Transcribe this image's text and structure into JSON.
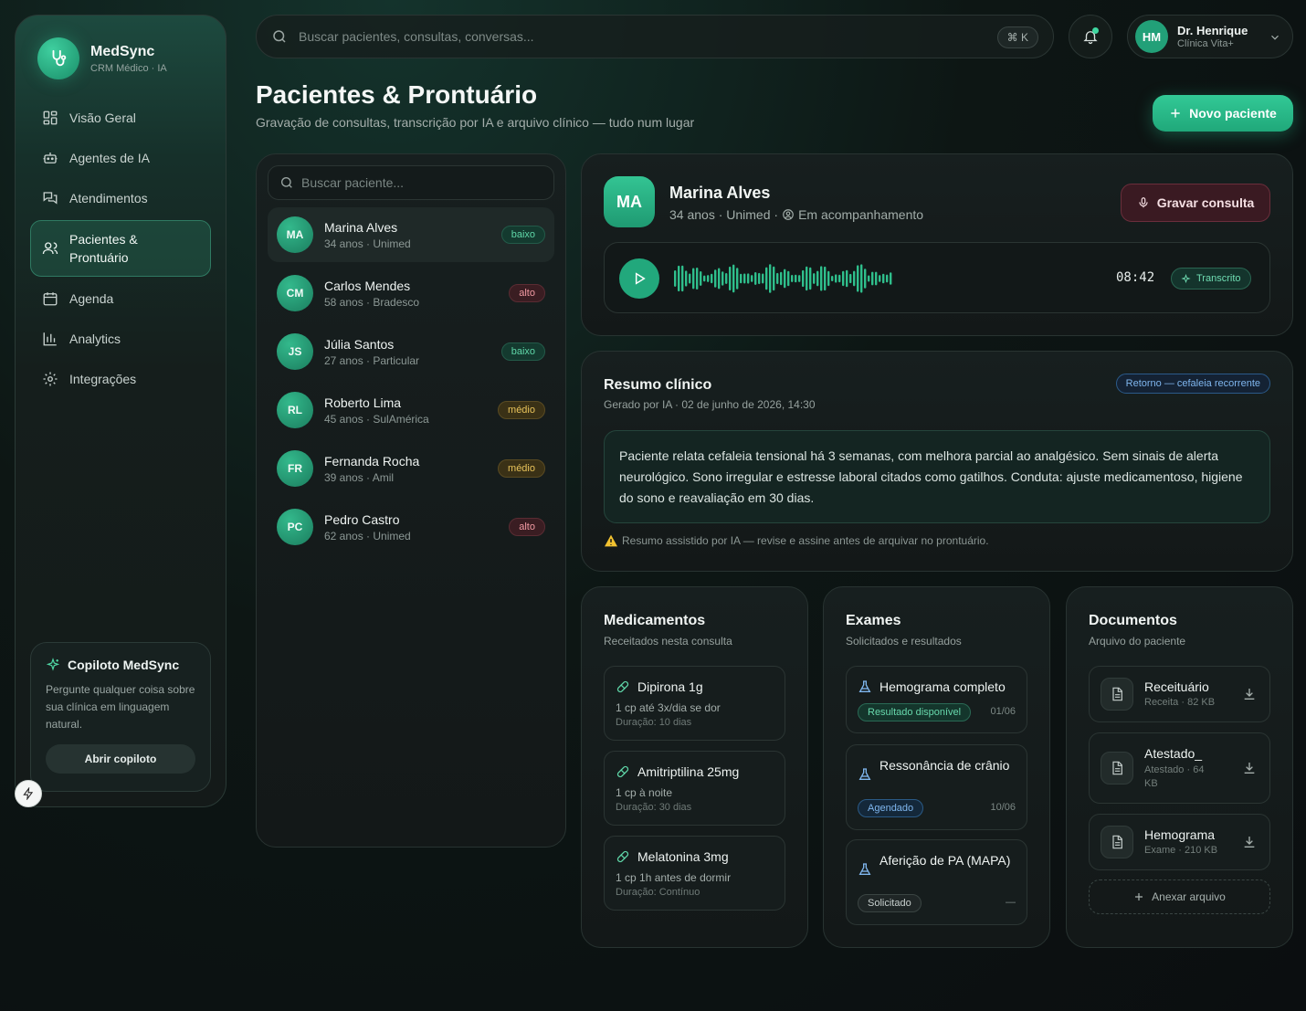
{
  "brand": {
    "name": "MedSync",
    "subtitle": "CRM Médico · IA"
  },
  "nav": [
    {
      "label": "Visão Geral",
      "icon": "grid-icon"
    },
    {
      "label": "Agentes de IA",
      "icon": "bot-icon"
    },
    {
      "label": "Atendimentos",
      "icon": "chat-icon"
    },
    {
      "label": "Pacientes & Prontuário",
      "icon": "users-icon",
      "active": true
    },
    {
      "label": "Agenda",
      "icon": "calendar-icon"
    },
    {
      "label": "Analytics",
      "icon": "bar-chart-icon"
    },
    {
      "label": "Integrações",
      "icon": "gear-icon"
    }
  ],
  "copilot": {
    "title": "Copiloto MedSync",
    "text": "Pergunte qualquer coisa sobre sua clínica em linguagem natural.",
    "button": "Abrir copiloto"
  },
  "topbar": {
    "search_placeholder": "Buscar pacientes, consultas, conversas...",
    "shortcut": "⌘ K",
    "user": {
      "initials": "HM",
      "name": "Dr. Henrique",
      "clinic": "Clínica Vita+"
    }
  },
  "header": {
    "title": "Pacientes & Prontuário",
    "subtitle": "Gravação de consultas, transcrição por IA e arquivo clínico — tudo num lugar",
    "new_button": "Novo paciente"
  },
  "patient_search_placeholder": "Buscar paciente...",
  "patients": [
    {
      "initials": "MA",
      "name": "Marina Alves",
      "meta": "34 anos · Unimed",
      "risk": "baixo",
      "level": "baixo"
    },
    {
      "initials": "CM",
      "name": "Carlos Mendes",
      "meta": "58 anos · Bradesco",
      "risk": "alto",
      "level": "alto"
    },
    {
      "initials": "JS",
      "name": "Júlia Santos",
      "meta": "27 anos · Particular",
      "risk": "baixo",
      "level": "baixo"
    },
    {
      "initials": "RL",
      "name": "Roberto Lima",
      "meta": "45 anos · SulAmérica",
      "risk": "médio",
      "level": "medio"
    },
    {
      "initials": "FR",
      "name": "Fernanda Rocha",
      "meta": "39 anos · Amil",
      "risk": "médio",
      "level": "medio"
    },
    {
      "initials": "PC",
      "name": "Pedro Castro",
      "meta": "62 anos · Unimed",
      "risk": "alto",
      "level": "alto"
    }
  ],
  "selected": {
    "initials": "MA",
    "name": "Marina Alves",
    "meta": "34 anos · Unimed ·",
    "status": "Em acompanhamento",
    "record_button": "Gravar consulta",
    "duration": "08:42",
    "transcribed_label": "Transcrito"
  },
  "summary": {
    "title": "Resumo clínico",
    "generated": "Gerado por IA · 02 de junho de 2026, 14:30",
    "tag": "Retorno — cefaleia recorrente",
    "text": "Paciente relata cefaleia tensional há 3 semanas, com melhora parcial ao analgésico. Sem sinais de alerta neurológico. Sono irregular e estresse laboral citados como gatilhos. Conduta: ajuste medicamentoso, higiene do sono e reavaliação em 30 dias.",
    "warning": "Resumo assistido por IA — revise e assine antes de arquivar no prontuário."
  },
  "medications": {
    "title": "Medicamentos",
    "subtitle": "Receitados nesta consulta",
    "items": [
      {
        "name": "Dipirona 1g",
        "dose": "1 cp até 3x/dia se dor",
        "duration": "Duração: 10 dias"
      },
      {
        "name": "Amitriptilina 25mg",
        "dose": "1 cp à noite",
        "duration": "Duração: 30 dias"
      },
      {
        "name": "Melatonina 3mg",
        "dose": "1 cp 1h antes de dormir",
        "duration": "Duração: Contínuo"
      }
    ]
  },
  "exams": {
    "title": "Exames",
    "subtitle": "Solicitados e resultados",
    "items": [
      {
        "name": "Hemograma completo",
        "status": "Resultado disponível",
        "date": "01/06"
      },
      {
        "name": "Ressonância de crânio",
        "status": "Agendado",
        "date": "10/06"
      },
      {
        "name": "Aferição de PA (MAPA)",
        "status": "Solicitado",
        "date": "—"
      }
    ]
  },
  "documents": {
    "title": "Documentos",
    "subtitle": "Arquivo do paciente",
    "items": [
      {
        "name": "Receituário",
        "meta": "Receita · 82 KB"
      },
      {
        "name": "Atestado_",
        "meta": "Atestado · 64 KB"
      },
      {
        "name": "Hemograma",
        "meta": "Exame · 210 KB"
      }
    ],
    "attach": "Anexar arquivo"
  },
  "colors": {
    "accent": "#22a87c",
    "risk_low": "#5fd6a8",
    "risk_high": "#f29aa3",
    "risk_mid": "#e8c35a",
    "record": "#6a2e3b"
  }
}
